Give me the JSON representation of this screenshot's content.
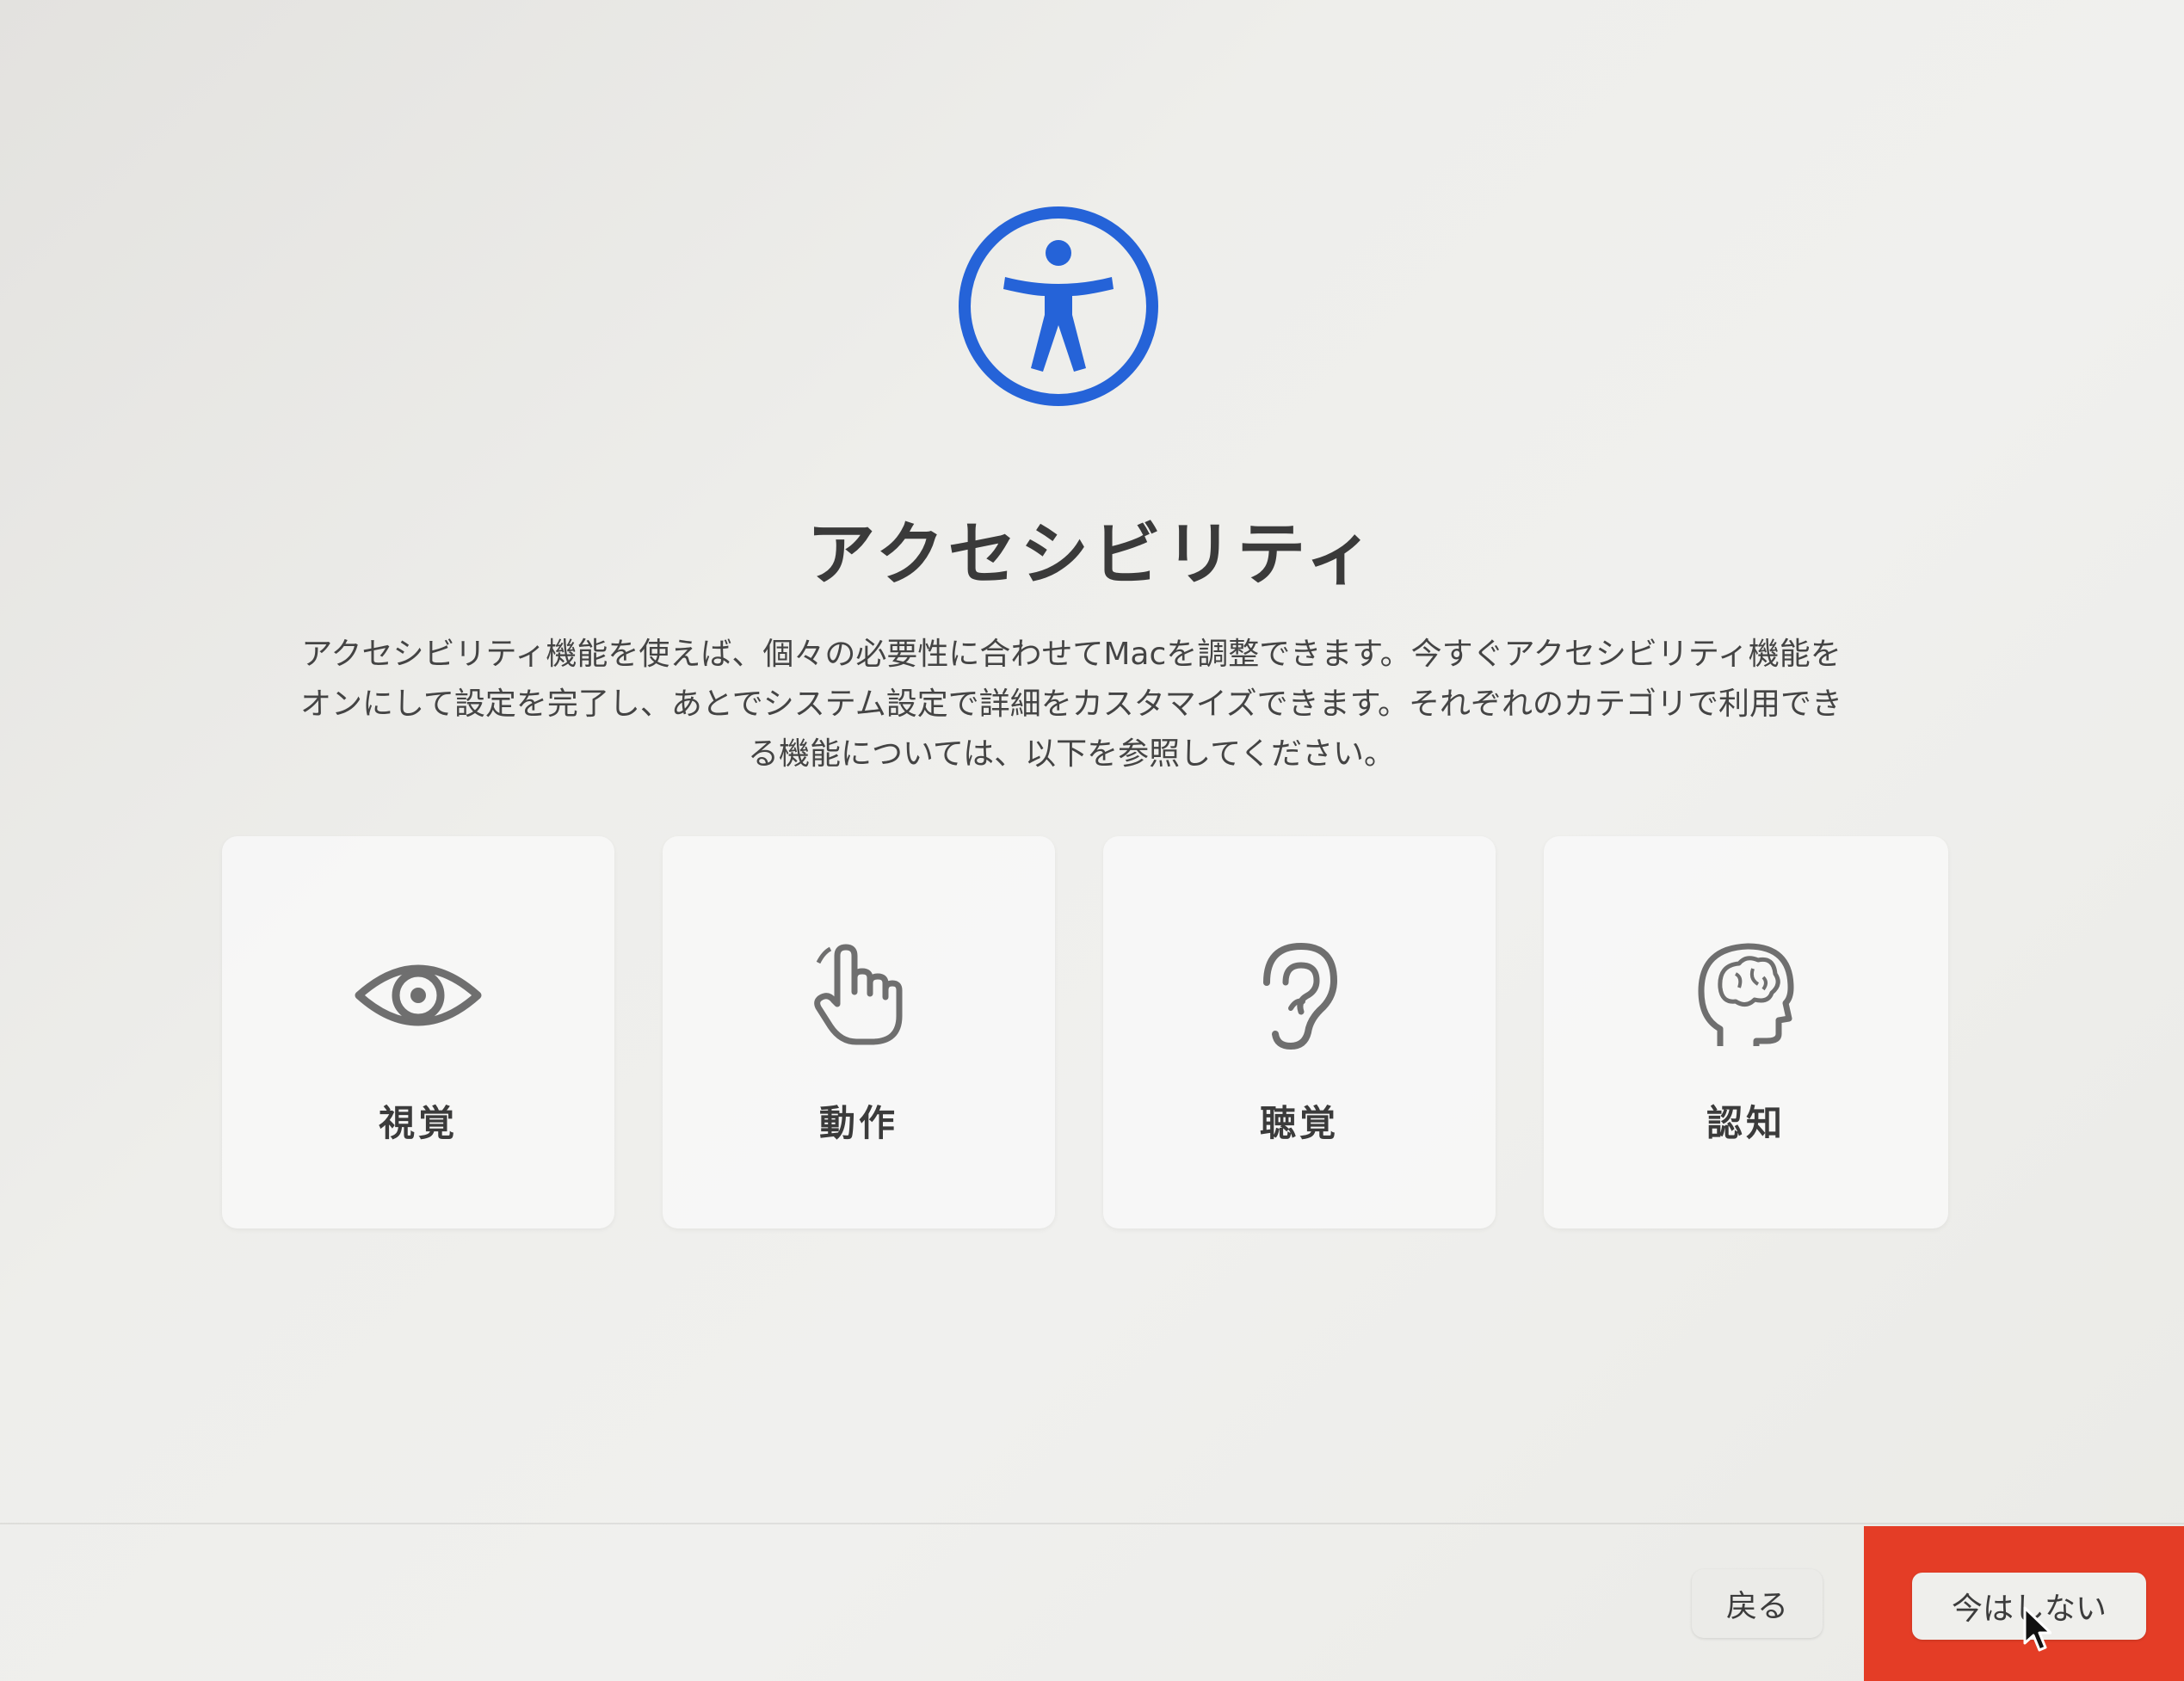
{
  "header": {
    "icon": "accessibility-icon",
    "accent_color": "#2563d8",
    "title": "アクセシビリティ"
  },
  "description": {
    "lines": [
      "アクセシビリティ機能を使えば、個々の必要性に合わせてMacを調整できます。今すぐアクセシビリティ機能を",
      "オンにして設定を完了し、あとでシステム設定で詳細をカスタマイズできます。それぞれのカテゴリで利用でき",
      "る機能については、以下を参照してください。"
    ]
  },
  "categories": [
    {
      "label": "視覚",
      "icon": "eye-icon"
    },
    {
      "label": "動作",
      "icon": "hand-pointer-icon"
    },
    {
      "label": "聴覚",
      "icon": "ear-icon"
    },
    {
      "label": "認知",
      "icon": "brain-head-icon"
    }
  ],
  "footer": {
    "back_label": "戻る",
    "not_now_label": "今はしない",
    "highlight_color": "#e43d26"
  }
}
